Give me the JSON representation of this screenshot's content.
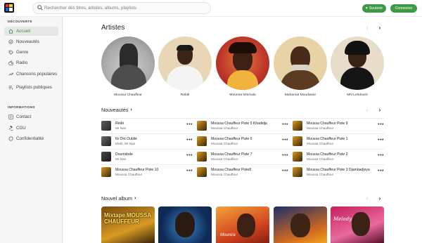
{
  "header": {
    "search_placeholder": "Rechercher des titres, artistes, albums, playlists",
    "support_label": "Soutenir",
    "login_label": "Connexion"
  },
  "sidebar": {
    "discover_title": "DÉCOUVERTE",
    "info_title": "INFORMATIONS",
    "discover_items": [
      {
        "label": "Accueil",
        "icon": "home-icon",
        "active": true
      },
      {
        "label": "Nouveautés",
        "icon": "new-icon"
      },
      {
        "label": "Genre",
        "icon": "tag-icon"
      },
      {
        "label": "Radio",
        "icon": "radio-icon"
      },
      {
        "label": "Chansons populaires",
        "icon": "trending-icon"
      },
      {
        "label": "Playlists publiques",
        "icon": "playlist-icon"
      }
    ],
    "info_items": [
      {
        "label": "Contact",
        "icon": "contact-icon"
      },
      {
        "label": "CGU",
        "icon": "gavel-icon"
      },
      {
        "label": "Confidentialité",
        "icon": "shield-icon"
      }
    ]
  },
  "artists_section": {
    "title": "Artistes",
    "artists": [
      {
        "name": "Moussa Chauffeur"
      },
      {
        "name": "Rafall"
      },
      {
        "name": "Mounira Mitchala"
      },
      {
        "name": "Mahamat Moudassir"
      },
      {
        "name": "MN Lehdouré"
      }
    ]
  },
  "new_section": {
    "title": "Nouveautés",
    "songs": [
      {
        "title": "Rédé",
        "artist": "Mr Nan"
      },
      {
        "title": "Moussa Chauffeur Piste 5 Khadidja",
        "artist": "Moussa Chauffeur"
      },
      {
        "title": "Moussa Chauffeur Piste 9",
        "artist": "Moussa Chauffeur"
      },
      {
        "title": "Ils Ont Oublié",
        "artist": "Elebl, Mr Nan"
      },
      {
        "title": "Moussa Chauffeur Piste 6",
        "artist": "Moussa Chauffeur"
      },
      {
        "title": "Moussa Chauffeur Piste 1",
        "artist": "Moussa Chauffeur"
      },
      {
        "title": "Doumdode",
        "artist": "Mr Nan"
      },
      {
        "title": "Moussa Chauffeur Piste 7",
        "artist": "Moussa Chauffeur"
      },
      {
        "title": "Moussa Chauffeur Piste 2",
        "artist": "Moussa Chauffeur"
      },
      {
        "title": "Moussa Chauffeur Piste 10",
        "artist": "Moussa Chauffeur"
      },
      {
        "title": "Moussa Chauffeur Piste8",
        "artist": "Moussa Chauffeur"
      },
      {
        "title": "Moussa Chauffeur Piste 3 Djambadjoya",
        "artist": "Moussa Chauffeur"
      }
    ]
  },
  "albums_section": {
    "title": "Nouvel album",
    "covers": [
      {
        "text": "Mixtape MOUSSA CHAUFFEUR"
      },
      {
        "text": ""
      },
      {
        "text": "Mounira"
      },
      {
        "text": ""
      },
      {
        "text": "Melody"
      }
    ]
  },
  "colors": {
    "accent": "#3f9a45",
    "active_nav": "#3b8e3f"
  }
}
